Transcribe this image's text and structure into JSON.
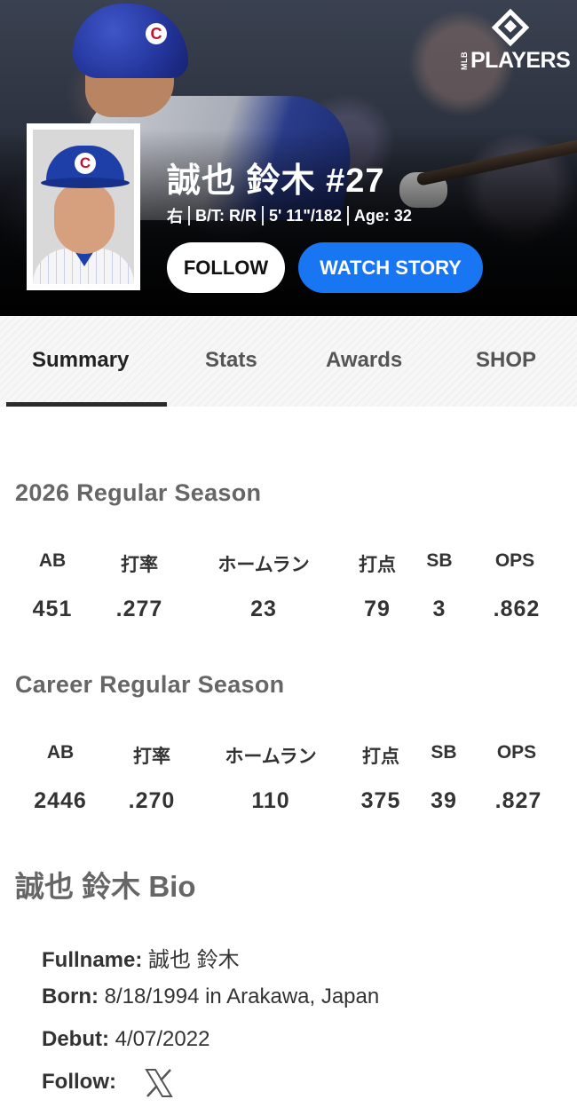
{
  "brand": {
    "logo_small": "MLB",
    "logo_word": "PLAYERS",
    "icon": "mlb-players-logo"
  },
  "hero": {
    "helmet_logo": "C",
    "cap_logo": "C"
  },
  "player": {
    "name": "誠也 鈴木 #27",
    "position": "右",
    "bats_throws": "B/T: R/R",
    "height_weight": "5' 11\"/182",
    "age": "Age: 32"
  },
  "actions": {
    "follow": "FOLLOW",
    "watch_story": "WATCH STORY"
  },
  "tabs": [
    {
      "label": "Summary",
      "active": true
    },
    {
      "label": "Stats",
      "active": false
    },
    {
      "label": "Awards",
      "active": false
    },
    {
      "label": "SHOP",
      "active": false
    }
  ],
  "season": {
    "title": "2026 Regular Season",
    "headers": [
      "AB",
      "打率",
      "ホームラン",
      "打点",
      "SB",
      "OPS"
    ],
    "values": [
      "451",
      ".277",
      "23",
      "79",
      "3",
      ".862"
    ]
  },
  "career": {
    "title": "Career Regular Season",
    "headers": [
      "AB",
      "打率",
      "ホームラン",
      "打点",
      "SB",
      "OPS"
    ],
    "values": [
      "2446",
      ".270",
      "110",
      "375",
      "39",
      ".827"
    ]
  },
  "bio": {
    "title": "誠也 鈴木 Bio",
    "fullname_label": "Fullname:",
    "fullname_value": "誠也 鈴木",
    "born_label": "Born:",
    "born_value": "8/18/1994 in Arakawa, Japan",
    "debut_label": "Debut:",
    "debut_value": "4/07/2022",
    "follow_label": "Follow:",
    "follow_icon": "x-twitter-icon"
  },
  "colors": {
    "accent": "#1976f3",
    "hero_bg": "#0f1116",
    "cubs_blue": "#1f3fa8",
    "cubs_red": "#c8102e"
  }
}
